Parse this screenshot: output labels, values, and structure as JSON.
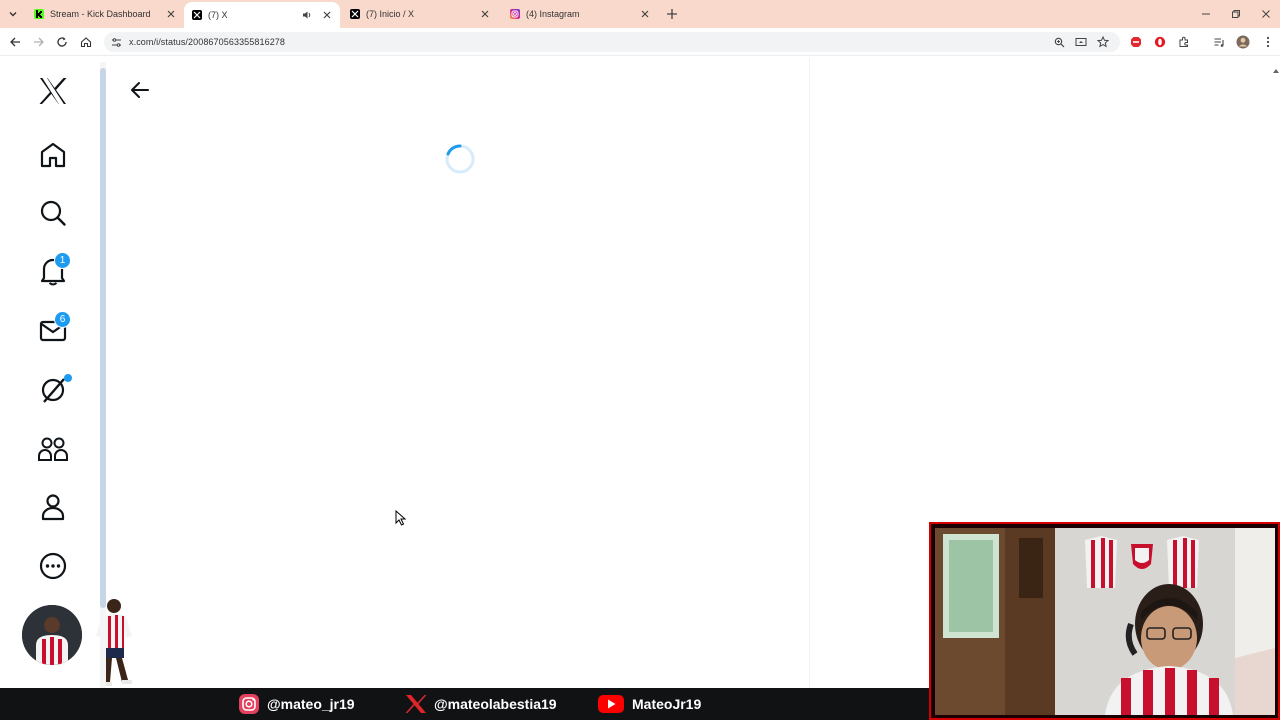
{
  "browser": {
    "tabs": [
      {
        "label": "Stream - Kick Dashboard",
        "favicon": "kick-logo-icon",
        "active": false
      },
      {
        "label": "(7) X",
        "favicon": "x-logo-icon",
        "active": true,
        "audio": true
      },
      {
        "label": "(7) Inicio / X",
        "favicon": "x-logo-icon",
        "active": false
      },
      {
        "label": "(4) Instagram",
        "favicon": "instagram-logo-icon",
        "active": false
      }
    ],
    "url": "x.com/i/status/2008670563355816278"
  },
  "sidebar": {
    "notifications_badge": "1",
    "messages_badge": "6"
  },
  "colors": {
    "accent": "#1d9bf0",
    "tabstrip": "#f9d9cc",
    "banner": "#111214",
    "webcam_border": "#d40000"
  },
  "stream_banner": {
    "instagram_handle": "@mateo_jr19",
    "x_handle": "@mateolabestia19",
    "youtube_handle": "MateoJr19"
  }
}
